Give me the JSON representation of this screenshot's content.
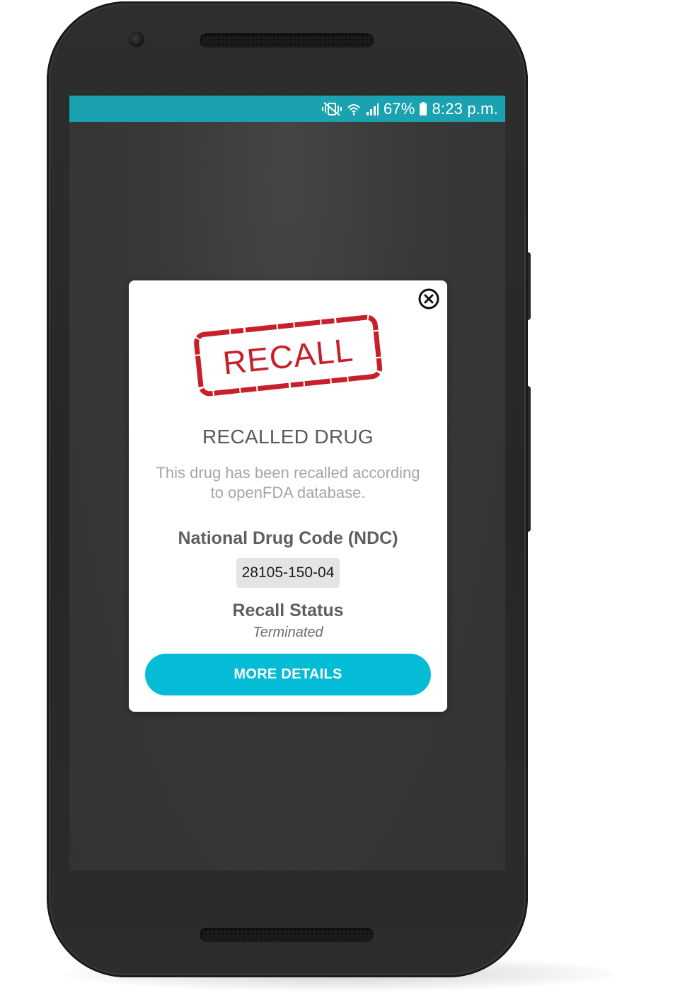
{
  "status_bar": {
    "icons": [
      "vibrate-icon",
      "wifi-icon",
      "signal-icon",
      "battery-icon"
    ],
    "battery_percent": "67%",
    "time": "8:23 p.m."
  },
  "modal": {
    "stamp_text": "RECALL",
    "title": "RECALLED DRUG",
    "description": "This drug has been recalled according to openFDA database.",
    "ndc_label": "National Drug Code (NDC)",
    "ndc_value": "28105-150-04",
    "recall_status_label": "Recall Status",
    "recall_status_value": "Terminated",
    "more_details_label": "MORE DETAILS",
    "close_icon": "close-circle-icon"
  },
  "colors": {
    "status_bar": "#1ba2b0",
    "accent_button": "#05bcd6",
    "stamp_red": "#c8202a",
    "screen_background": "#383838",
    "phone_body": "#2a2a2a"
  }
}
